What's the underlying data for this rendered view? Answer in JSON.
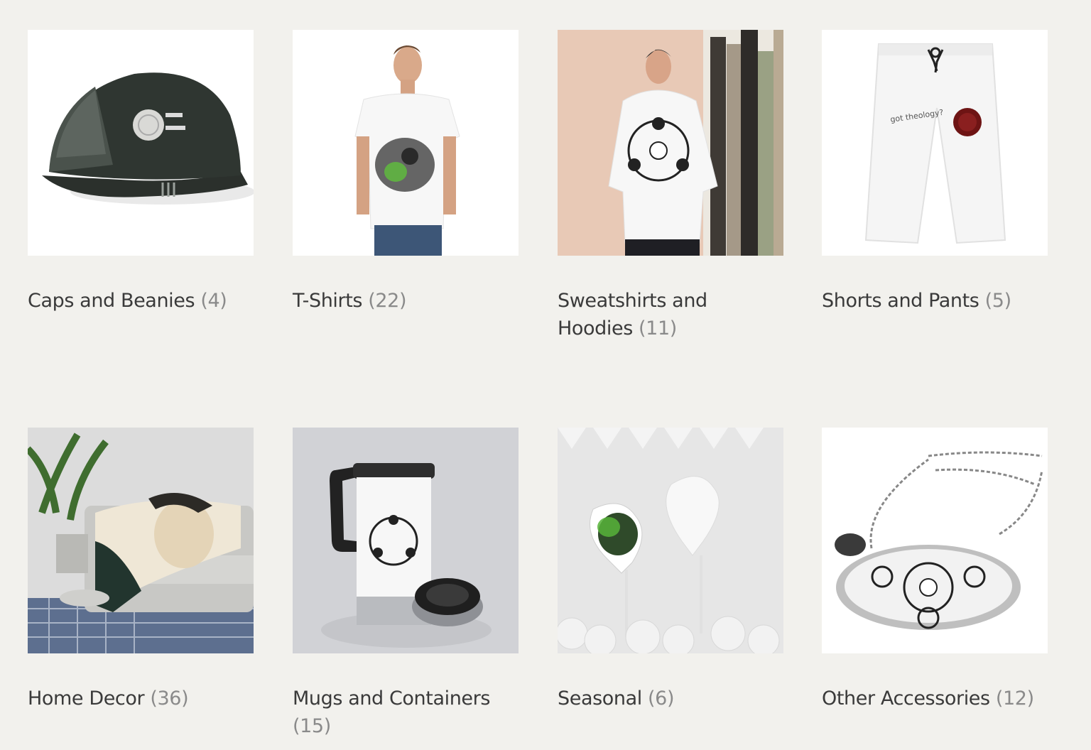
{
  "categories": [
    {
      "name": "Caps and Beanies",
      "count": "(4)",
      "image": "cap-product-image"
    },
    {
      "name": "T-Shirts",
      "count": "(22)",
      "image": "tshirt-product-image"
    },
    {
      "name": "Sweatshirts and Hoodies",
      "count": "(11)",
      "image": "hoodie-product-image"
    },
    {
      "name": "Shorts and Pants",
      "count": "(5)",
      "image": "pants-product-image",
      "image_text": "got theology?"
    },
    {
      "name": "Home Decor",
      "count": "(36)",
      "image": "blanket-product-image"
    },
    {
      "name": "Mugs and Containers",
      "count": "(15)",
      "image": "mug-product-image"
    },
    {
      "name": "Seasonal",
      "count": "(6)",
      "image": "balloon-product-image"
    },
    {
      "name": "Other Accessories",
      "count": "(12)",
      "image": "necklace-product-image"
    }
  ]
}
